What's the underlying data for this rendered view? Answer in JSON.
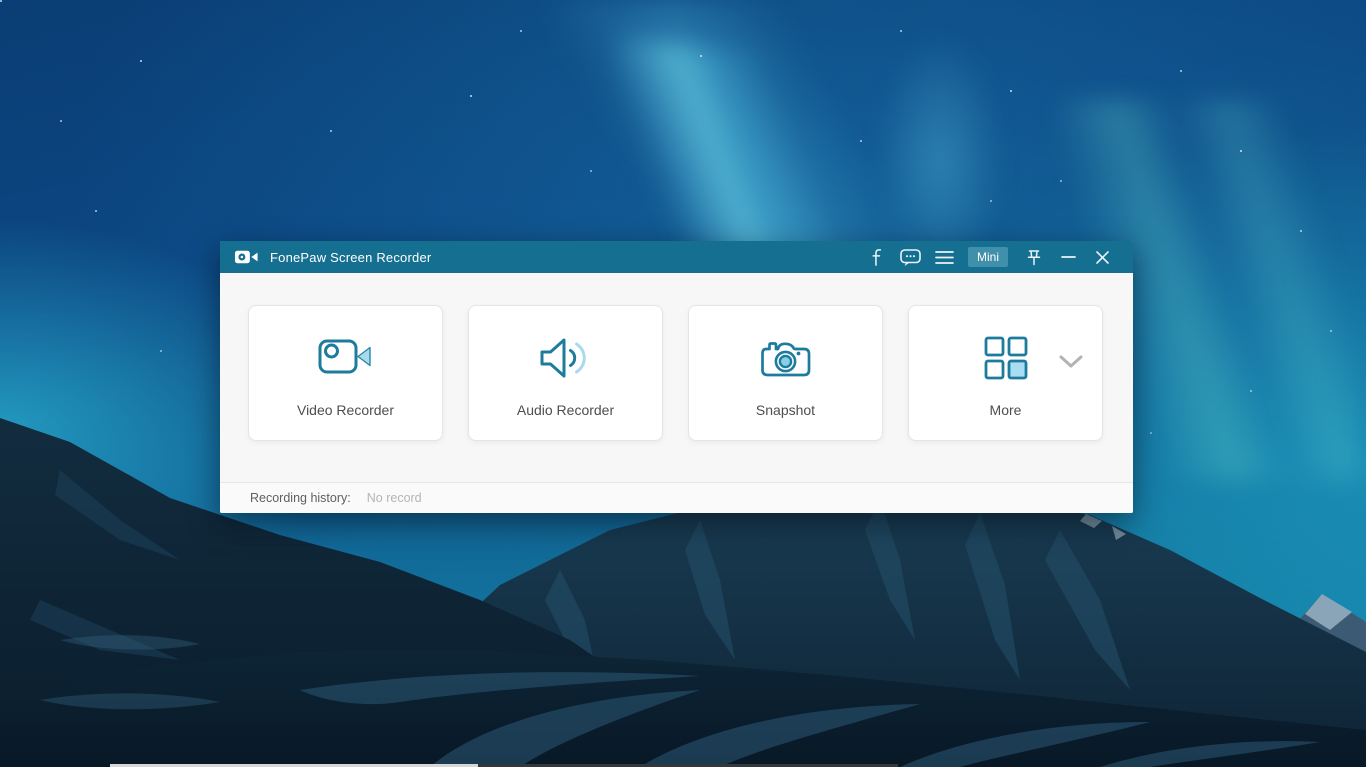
{
  "app": {
    "title": "FonePaw Screen Recorder",
    "titlebar": {
      "app_icon": "video-camera-logo-icon",
      "mini_button_label": "Mini",
      "icons": [
        "facebook-icon",
        "feedback-bubble-icon",
        "menu-icon",
        "pin-icon",
        "minimize-icon",
        "close-icon"
      ]
    },
    "cards": [
      {
        "label": "Video Recorder",
        "icon": "video-camera-icon"
      },
      {
        "label": "Audio Recorder",
        "icon": "speaker-icon"
      },
      {
        "label": "Snapshot",
        "icon": "camera-icon"
      },
      {
        "label": "More",
        "icon": "grid-icon",
        "extra_icon": "chevron-down-icon"
      }
    ],
    "footer": {
      "history_label": "Recording history:",
      "history_value": "No record"
    },
    "colors": {
      "titlebar_bg": "#156f90",
      "mini_button_bg": "#4090ac",
      "accent": "#1d7b9e",
      "accent_light": "#a9d9ec",
      "content_bg": "#f7f7f8"
    }
  }
}
